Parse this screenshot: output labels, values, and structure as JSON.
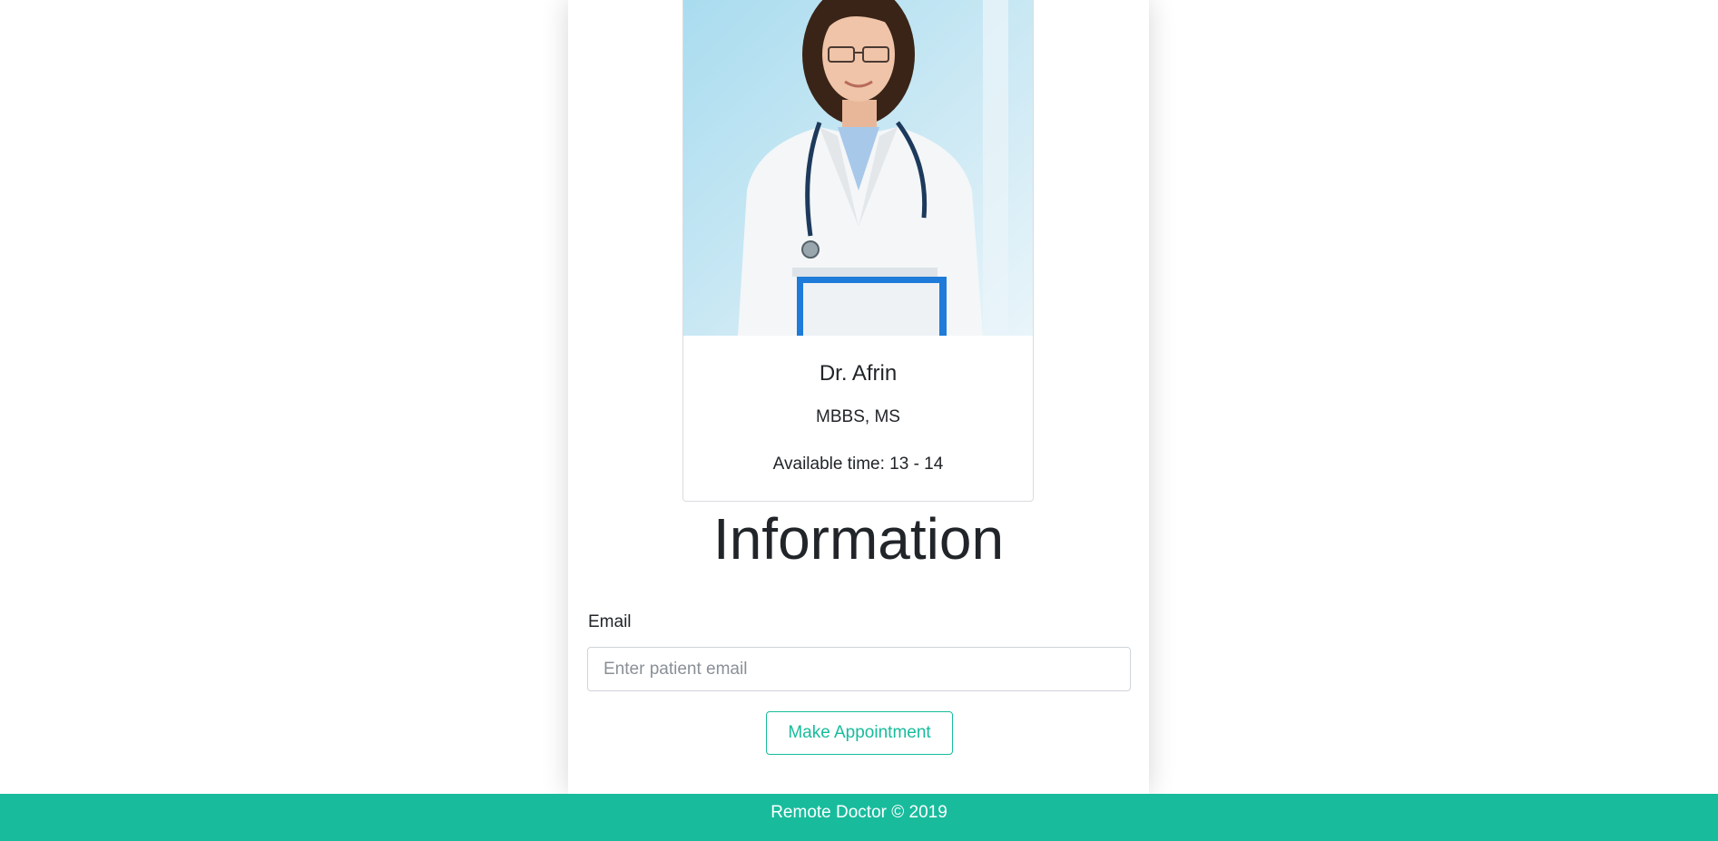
{
  "doctor": {
    "name": "Dr. Afrin",
    "degree": "MBBS, MS",
    "available_time": "Available time: 13 - 14"
  },
  "information": {
    "heading": "Information",
    "email_label": "Email",
    "email_placeholder": "Enter patient email",
    "email_value": "",
    "button_label": "Make Appointment"
  },
  "footer": {
    "text": "Remote Doctor © 2019"
  },
  "colors": {
    "accent": "#18bc9c",
    "text": "#212529",
    "border": "#ced4da"
  }
}
